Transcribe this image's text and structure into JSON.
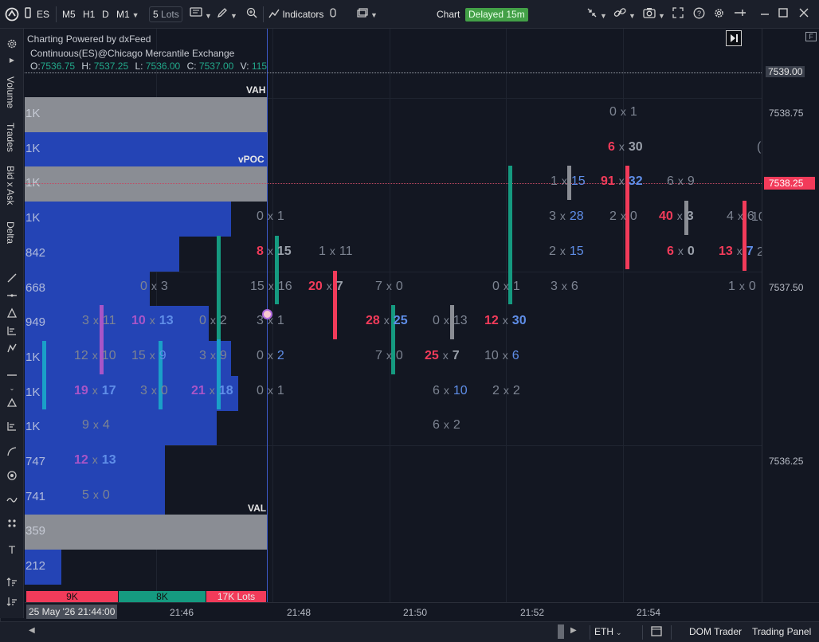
{
  "toolbar": {
    "symbol": "ES",
    "timeframes": [
      "M5",
      "H1",
      "D"
    ],
    "active_tf": "M1",
    "lots": "5",
    "lots_unit": "Lots",
    "indicators_label": "Indicators",
    "chart_label": "Chart",
    "delayed_badge": "Delayed 15m"
  },
  "chart_info": {
    "powered_by": "Charting Powered by dxFeed",
    "instrument": "Continuous(ES)@Chicago Mercantile Exchange",
    "o_label": "O:",
    "o": "7536.75",
    "h_label": "H:",
    "h": "7537.25",
    "l_label": "L:",
    "l": "7536.00",
    "c_label": "C:",
    "c": "7537.00",
    "v_label": "V:",
    "v": "115"
  },
  "left_panel_tabs": [
    "Volume",
    "Trades",
    "Bid x Ask",
    "Delta"
  ],
  "volume_profile": {
    "vah_label": "VAH",
    "vpoc_label": "vPOC",
    "val_label": "VAL",
    "rows": [
      "1K",
      "1K",
      "1K",
      "1K",
      "842",
      "668",
      "949",
      "1K",
      "1K",
      "1K",
      "747",
      "741",
      "359",
      "212"
    ],
    "row_values": [
      0.33,
      0.33,
      0.33,
      0.28,
      0.21,
      0.17,
      0.25,
      0.28,
      0.29,
      0.26,
      0.19,
      0.19,
      0.33,
      0.05
    ]
  },
  "footprint_cells": [
    {
      "bid": "0",
      "ask": "x 1",
      "row": 3,
      "col": 0
    },
    {
      "bid": "8",
      "ask": "15",
      "row": 4,
      "col": 0,
      "bidc": "red",
      "askc": "gray",
      "bold": true
    },
    {
      "bid": "15",
      "ask": "16",
      "row": 5,
      "col": 0
    },
    {
      "bid": "3",
      "ask": "1",
      "row": 6,
      "col": 0
    },
    {
      "bid": "0",
      "ask": "2",
      "row": 7,
      "col": 0,
      "askc": "blue"
    },
    {
      "bid": "0",
      "ask": "1",
      "row": 8,
      "col": 0
    }
  ],
  "cells_text": [
    {
      "t": "0 x 3",
      "row": 5,
      "c": 145
    },
    {
      "t": "3 x 11",
      "row": 6,
      "c": 72
    },
    {
      "t": "10 x 13",
      "row": 6,
      "c": 134,
      "bidc": "#a855c7",
      "askc": "#5f8ee8",
      "bold": true
    },
    {
      "t": "0 x 2",
      "row": 6,
      "c": 219
    },
    {
      "t": "12 x 10",
      "row": 7,
      "c": 62
    },
    {
      "t": "15 x 9",
      "row": 7,
      "c": 134,
      "askc": "#5f8ee8"
    },
    {
      "t": "3 x 9",
      "row": 7,
      "c": 219
    },
    {
      "t": "19 x 17",
      "row": 8,
      "c": 62,
      "bidc": "#a855c7",
      "askc": "#5f8ee8",
      "bold": true
    },
    {
      "t": "3 x 0",
      "row": 8,
      "c": 145
    },
    {
      "t": "21 x 18",
      "row": 8,
      "c": 209,
      "bidc": "#a855c7",
      "askc": "#5f8ee8",
      "bold": true
    },
    {
      "t": "9 x 4",
      "row": 9,
      "c": 72
    },
    {
      "t": "12 x 13",
      "row": 10,
      "c": 62,
      "bidc": "#a855c7",
      "askc": "#5f8ee8",
      "bold": true
    },
    {
      "t": "5 x 0",
      "row": 11,
      "c": 72
    },
    {
      "t": "0 x 1",
      "row": 3,
      "c": 291
    },
    {
      "t": "8 x 15",
      "row": 4,
      "c": 291,
      "bidc": "#f23b5a",
      "askc": "#9aa0aa",
      "bold": true
    },
    {
      "t": "15 x 16",
      "row": 5,
      "c": 283
    },
    {
      "t": "3 x 1",
      "row": 6,
      "c": 291
    },
    {
      "t": "0 x 2",
      "row": 7,
      "c": 291,
      "askc": "#5f8ee8"
    },
    {
      "t": "0 x 1",
      "row": 8,
      "c": 291
    },
    {
      "t": "1 x 11",
      "row": 4,
      "c": 369
    },
    {
      "t": "20 x 7",
      "row": 5,
      "c": 356,
      "bidc": "#f23b5a",
      "askc": "#9aa0aa",
      "bold": true
    },
    {
      "t": "7 x 0",
      "row": 5,
      "c": 440
    },
    {
      "t": "28 x 25",
      "row": 6,
      "c": 428,
      "bidc": "#f23b5a",
      "askc": "#5f8ee8",
      "bold": true
    },
    {
      "t": "7 x 0",
      "row": 7,
      "c": 440
    },
    {
      "t": "0 x 13",
      "row": 6,
      "c": 512
    },
    {
      "t": "25 x 7",
      "row": 7,
      "c": 502,
      "bidc": "#f23b5a",
      "askc": "#9aa0aa",
      "bold": true
    },
    {
      "t": "6 x 10",
      "row": 8,
      "c": 512,
      "askc": "#5f8ee8"
    },
    {
      "t": "6 x 2",
      "row": 9,
      "c": 512
    },
    {
      "t": "0 x 1",
      "row": 5,
      "c": 587
    },
    {
      "t": "12 x 30",
      "row": 6,
      "c": 577,
      "bidc": "#f23b5a",
      "askc": "#5f8ee8",
      "bold": true
    },
    {
      "t": "10 x 6",
      "row": 7,
      "c": 577,
      "askc": "#5f8ee8"
    },
    {
      "t": "2 x 2",
      "row": 8,
      "c": 587
    },
    {
      "t": "1 x 15",
      "row": 2,
      "c": 660,
      "askc": "#5f8ee8"
    },
    {
      "t": "3 x 28",
      "row": 3,
      "c": 658,
      "askc": "#5f8ee8"
    },
    {
      "t": "2 x 15",
      "row": 4,
      "c": 658,
      "askc": "#5f8ee8"
    },
    {
      "t": "3 x 6",
      "row": 5,
      "c": 660
    },
    {
      "t": "0 x 1",
      "row": 0,
      "c": 734
    },
    {
      "t": "6 x 30",
      "row": 1,
      "c": 732,
      "bidc": "#f23b5a",
      "askc": "#9aa0aa",
      "bold": true
    },
    {
      "t": "91 x 32",
      "row": 2,
      "c": 723,
      "bidc": "#f23b5a",
      "askc": "#5f8ee8",
      "bold": true
    },
    {
      "t": "2 x 0",
      "row": 3,
      "c": 734
    },
    {
      "t": "6 x 9",
      "row": 2,
      "c": 806
    },
    {
      "t": "40 x 3",
      "row": 3,
      "c": 796,
      "bidc": "#f23b5a",
      "askc": "#9aa0aa",
      "bold": true
    },
    {
      "t": "6 x 0",
      "row": 4,
      "c": 806,
      "bidc": "#f23b5a",
      "askc": "#9aa0aa",
      "bold": true
    },
    {
      "t": "4 x 6",
      "row": 3,
      "c": 881
    },
    {
      "t": "13 x 7",
      "row": 4,
      "c": 871,
      "bidc": "#f23b5a",
      "askc": "#5f8ee8",
      "bold": true
    },
    {
      "t": "1 x 0",
      "row": 5,
      "c": 883
    }
  ],
  "bottom_volume": {
    "b1": "9K",
    "b2": "8K",
    "b3": "17K Lots"
  },
  "price_axis": [
    "7539.00",
    "7538.75",
    "7538.25",
    "7537.50",
    "7536.25"
  ],
  "current_price": "7538.25",
  "time_axis": [
    "21:46",
    "21:48",
    "21:50",
    "21:52",
    "21:54"
  ],
  "time_cursor": "25 May '26 21:44:00",
  "bottombar": {
    "session": "ETH",
    "dom": "DOM Trader",
    "panel": "Trading Panel"
  },
  "colors": {
    "bg": "#131722",
    "green": "#159a80",
    "red": "#f23b5a",
    "blue": "#2444b5",
    "gray": "#8a8d94",
    "delayed": "#43a047"
  }
}
